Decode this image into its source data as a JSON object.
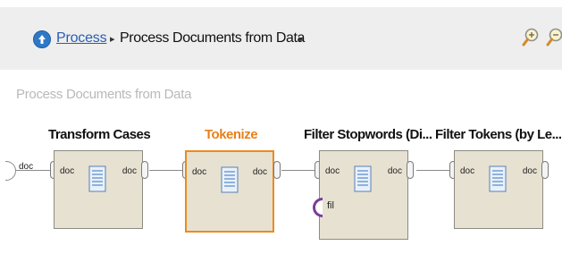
{
  "breadcrumb": {
    "items": [
      {
        "label": "Process",
        "link": true
      },
      {
        "label": "Process Documents from Data",
        "link": false
      }
    ],
    "separator": "▸"
  },
  "panel": {
    "title": "Process Documents from Data"
  },
  "source_port": {
    "label": "doc"
  },
  "operators": [
    {
      "name": "Transform Cases",
      "selected": false,
      "input": "doc",
      "output": "doc"
    },
    {
      "name": "Tokenize",
      "selected": true,
      "input": "doc",
      "output": "doc"
    },
    {
      "name": "Filter Stopwords (Di...",
      "selected": false,
      "input": "doc",
      "output": "doc",
      "extra_input": "fil"
    },
    {
      "name": "Filter Tokens (by Le...",
      "selected": false,
      "input": "doc",
      "output": "doc"
    }
  ],
  "colors": {
    "link": "#2a5db0",
    "selected": "#ee8a1e",
    "operator_fill": "#e7e1d2",
    "extra_port": "#7a3c98"
  },
  "icons": [
    "navigate-up-icon",
    "zoom-in-icon",
    "zoom-out-icon",
    "document-icon"
  ]
}
